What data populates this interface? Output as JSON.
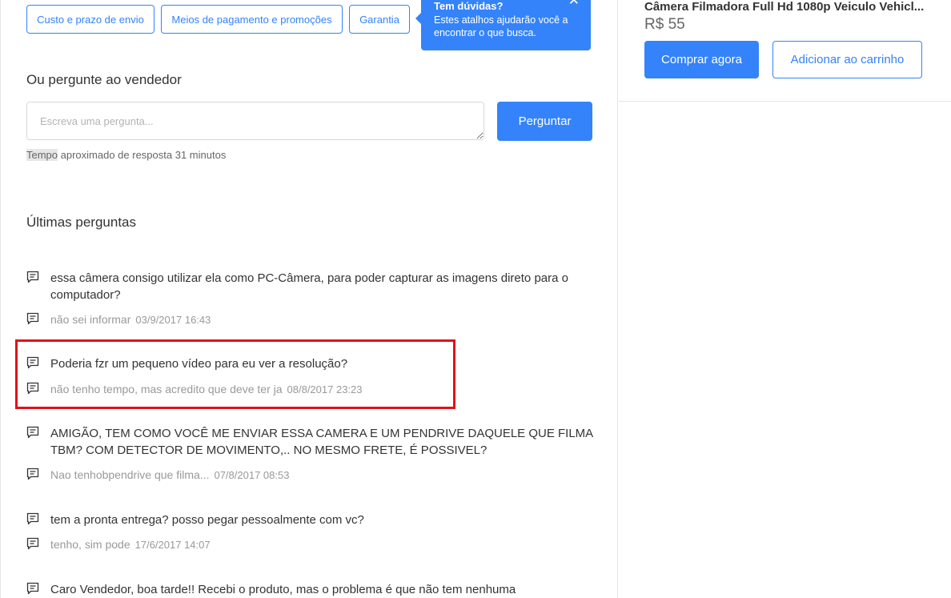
{
  "shortcuts": {
    "shipping": "Custo e prazo de envio",
    "payment": "Meios de pagamento e promoções",
    "warranty": "Garantia"
  },
  "tooltip": {
    "title": "Tem dúvidas?",
    "body": "Estes atalhos ajudarão você a encontrar o que busca.",
    "close": "✕"
  },
  "ask": {
    "heading": "Ou pergunte ao vendedor",
    "placeholder": "Escreva uma pergunta...",
    "button": "Perguntar",
    "response_time_prefix": "Tempo",
    "response_time_rest": " aproximado de resposta 31 minutos"
  },
  "latest": {
    "heading": "Últimas perguntas",
    "items": [
      {
        "question": "essa câmera consigo utilizar ela como PC-Câmera, para poder capturar as imagens direto para o computador?",
        "answer": "não sei informar",
        "date": "03/9/2017 16:43"
      },
      {
        "question": "Poderia fzr um pequeno vídeo para eu ver a resolução?",
        "answer": "não tenho tempo, mas acredito que deve ter ja",
        "date": "08/8/2017 23:23"
      },
      {
        "question": "AMIGÃO, TEM COMO VOCÊ ME ENVIAR ESSA CAMERA E UM PENDRIVE DAQUELE QUE FILMA TBM? COM DETECTOR DE MOVIMENTO,.. NO MESMO FRETE, É POSSIVEL?",
        "answer": "Nao tenhobpendrive que filma...",
        "date": "07/8/2017 08:53"
      },
      {
        "question": "tem a pronta entrega? posso pegar pessoalmente com vc?",
        "answer": "tenho, sim pode",
        "date": "17/6/2017 14:07"
      },
      {
        "question": "Caro Vendedor, boa tarde!! Recebi o produto, mas o problema é que não tem nenhuma"
      }
    ]
  },
  "product": {
    "title": "Câmera Filmadora Full Hd 1080p Veiculo Vehicl...",
    "price": "R$ 55",
    "buy_button": "Comprar agora",
    "cart_button": "Adicionar ao carrinho"
  },
  "colors": {
    "accent": "#3483fa",
    "highlight": "#e0131a"
  },
  "icons": {
    "comment": "comment-icon"
  }
}
